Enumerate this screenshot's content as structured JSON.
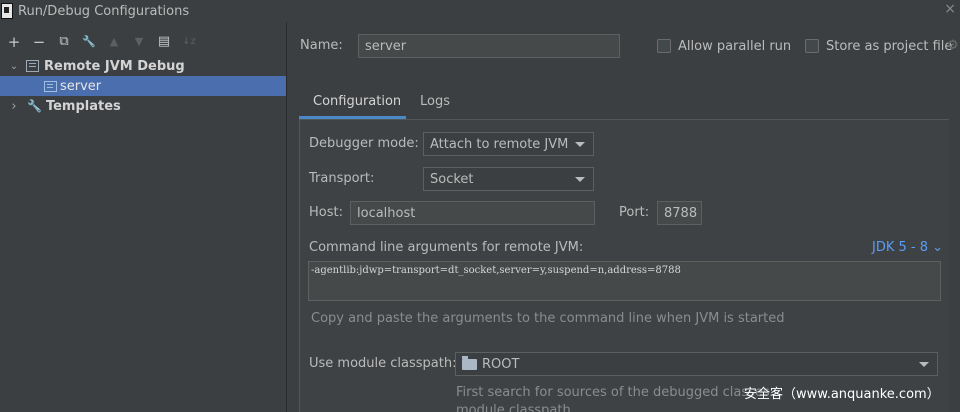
{
  "window": {
    "title": "Run/Debug Configurations",
    "close_glyph": "×"
  },
  "toolbar": {
    "items": [
      {
        "name": "add-icon",
        "glyph": "+"
      },
      {
        "name": "remove-icon",
        "glyph": "−"
      },
      {
        "name": "copy-icon",
        "glyph": "⧉"
      },
      {
        "name": "wrench-icon",
        "glyph": "🔧"
      },
      {
        "name": "move-up-icon",
        "glyph": "▲"
      },
      {
        "name": "move-down-icon",
        "glyph": "▼"
      },
      {
        "name": "folder-add-icon",
        "glyph": "▤"
      },
      {
        "name": "sort-icon",
        "glyph": "↓z"
      }
    ]
  },
  "tree": {
    "group_label": "Remote JVM Debug",
    "group_caret": "⌄",
    "child_label": "server",
    "templates_label": "Templates",
    "templates_caret": "›"
  },
  "form": {
    "name_label": "Name:",
    "name_value": "server",
    "allow_parallel_label": "Allow parallel run",
    "store_project_label": "Store as project file",
    "tabs": [
      "Configuration",
      "Logs"
    ],
    "debugger_mode_label": "Debugger mode:",
    "debugger_mode_value": "Attach to remote JVM",
    "transport_label": "Transport:",
    "transport_value": "Socket",
    "host_label": "Host:",
    "host_value": "localhost",
    "port_label": "Port:",
    "port_value": "8788",
    "cmd_label": "Command line arguments for remote JVM:",
    "jdk_link": "JDK 5 - 8 ⌄",
    "cmd_value": "-agentlib:jdwp=transport=dt_socket,server=y,suspend=n,address=8788",
    "cmd_hint": "Copy and paste the arguments to the command line when JVM is started",
    "module_label": "Use module classpath:",
    "module_value": "ROOT",
    "module_hint_line1": "First search for sources of the debugged classes",
    "module_hint_line2": "module classpath"
  },
  "watermark": "安全客（www.anquanke.com）",
  "colors": {
    "accent": "#4b6eaf",
    "link": "#589df6",
    "tab_underline": "#4a88c7"
  }
}
